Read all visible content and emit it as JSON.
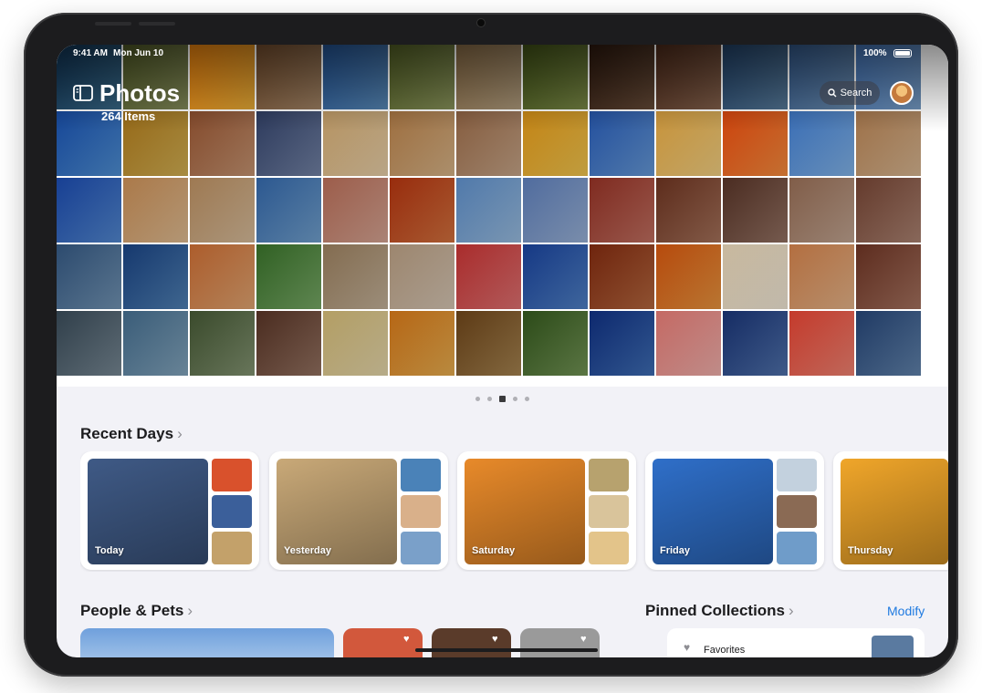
{
  "status": {
    "time": "9:41 AM",
    "date": "Mon Jun 10",
    "battery": "100%"
  },
  "header": {
    "title": "Photos",
    "item_count": "264 Items",
    "search_label": "Search"
  },
  "sections": {
    "recent_days": "Recent Days",
    "people_pets": "People & Pets",
    "pinned": "Pinned Collections",
    "modify": "Modify"
  },
  "recent_days": [
    {
      "label": "Today",
      "colors": [
        "#3f5a86",
        "#d9512c",
        "#3b5f9a",
        "#c3a16a"
      ]
    },
    {
      "label": "Yesterday",
      "colors": [
        "#c9a978",
        "#4a82b8",
        "#d9b08a",
        "#7aa0c9"
      ]
    },
    {
      "label": "Saturday",
      "colors": [
        "#e88a2a",
        "#b7a26e",
        "#d9c49b",
        "#e3c48a"
      ]
    },
    {
      "label": "Friday",
      "colors": [
        "#2f6fc9",
        "#c3d1de",
        "#8a6a54",
        "#6f9cc9"
      ]
    },
    {
      "label": "Thursday",
      "colors": [
        "#f0a62a"
      ]
    }
  ],
  "pinned": {
    "favorites": "Favorites"
  },
  "grid_colors": [
    "#3c6f8f",
    "#8c9460",
    "#f3b53a",
    "#a98a6a",
    "#5c8fbf",
    "#8f9a5f",
    "#b8a383",
    "#7f8f4a",
    "#6a4e3a",
    "#8a6650",
    "#5a7fa0",
    "#6f93b8",
    "#7ea6d1",
    "#4a86c5",
    "#c4a44e",
    "#b88a6a",
    "#6b7a9a",
    "#d8c29e",
    "#c9a87f",
    "#b99a7f",
    "#e0b84a",
    "#5f8fc9",
    "#e2c27a",
    "#e5833a",
    "#7aa8d8",
    "#c9aa88",
    "#4d7fc2",
    "#d1b089",
    "#c9b091",
    "#6a96c0",
    "#c89a8a",
    "#c56a3a",
    "#8fb0d1",
    "#8fa6c9",
    "#b4685a",
    "#9a6a54",
    "#8a6a5c",
    "#b59a88",
    "#a07a6a",
    "#6a8aa8",
    "#4a78a8",
    "#d29a6a",
    "#6f9d5f",
    "#b7a68f",
    "#c8b9a8",
    "#d06a6a",
    "#4a78b8",
    "#a8603a",
    "#d88a3a",
    "#e2d9c9",
    "#d6a880",
    "#9a6a58",
    "#6f7f8a",
    "#7a9ab0",
    "#7a8a6a",
    "#8a6a5a",
    "#d6c9a0",
    "#d8a24a",
    "#9a7a4a",
    "#6a8a4f",
    "#3a66a8",
    "#e0a4a0",
    "#4a6aa0",
    "#e07a6a",
    "#5a7aa0"
  ]
}
